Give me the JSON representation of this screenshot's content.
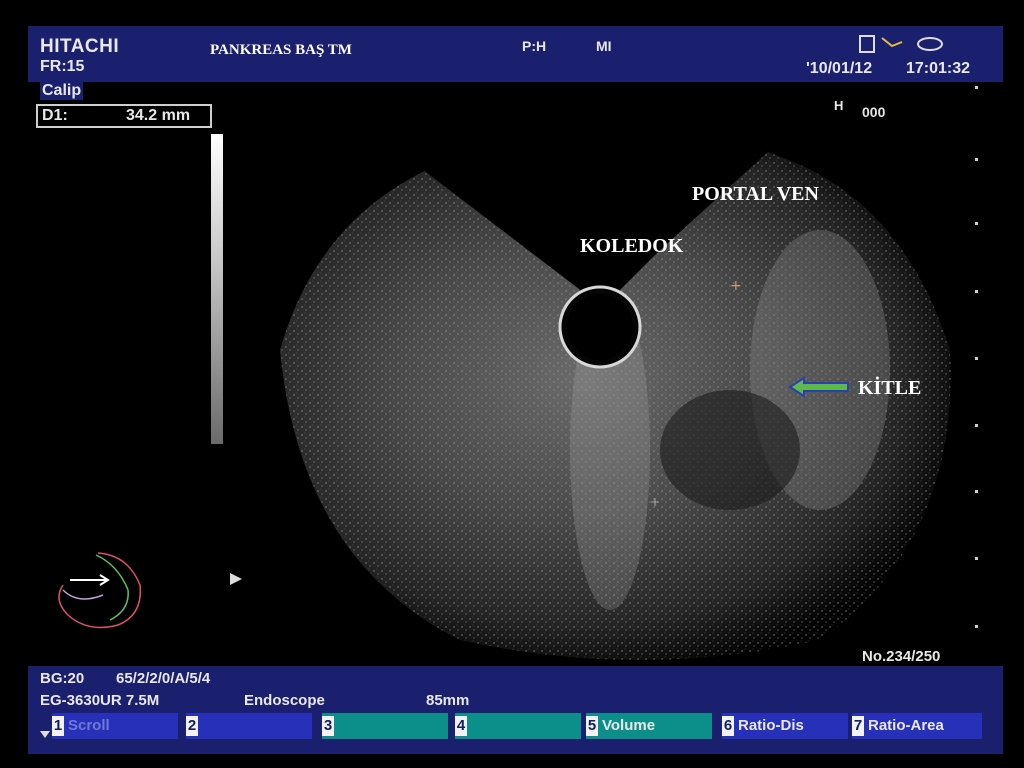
{
  "header": {
    "brand": "HITACHI",
    "frame_rate": "FR:15",
    "title": "PANKREAS BAŞ TM",
    "ph": "P:H",
    "mi": "MI",
    "date": "'10/01/12",
    "time": "17:01:32"
  },
  "measure": {
    "mode": "Calip",
    "d1_label": "D1:",
    "d1_value": "34.2 mm"
  },
  "image": {
    "h_label": "H",
    "h_value": "000",
    "annotations": {
      "portal": "PORTAL VEN",
      "koledok": "KOLEDOK",
      "kitle": "KİTLE"
    },
    "arrow_color": "#5fb84a",
    "frame_counter": "No.234/250"
  },
  "footer": {
    "bg": "BG:20",
    "params": "65/2/2/0/A/5/4",
    "probe": "EG-3630UR 7.5M",
    "mode": "Endoscope",
    "depth": "85mm",
    "keys": [
      {
        "num": "1",
        "label": "Scroll"
      },
      {
        "num": "2",
        "label": ""
      },
      {
        "num": "3",
        "label": ""
      },
      {
        "num": "4",
        "label": ""
      },
      {
        "num": "5",
        "label": "Volume"
      },
      {
        "num": "6",
        "label": "Ratio-Dis"
      },
      {
        "num": "7",
        "label": "Ratio-Area"
      }
    ]
  },
  "colors": {
    "panel": "#1a1f6e",
    "key_blue": "#2730b8",
    "key_teal": "#0c8f8a"
  }
}
